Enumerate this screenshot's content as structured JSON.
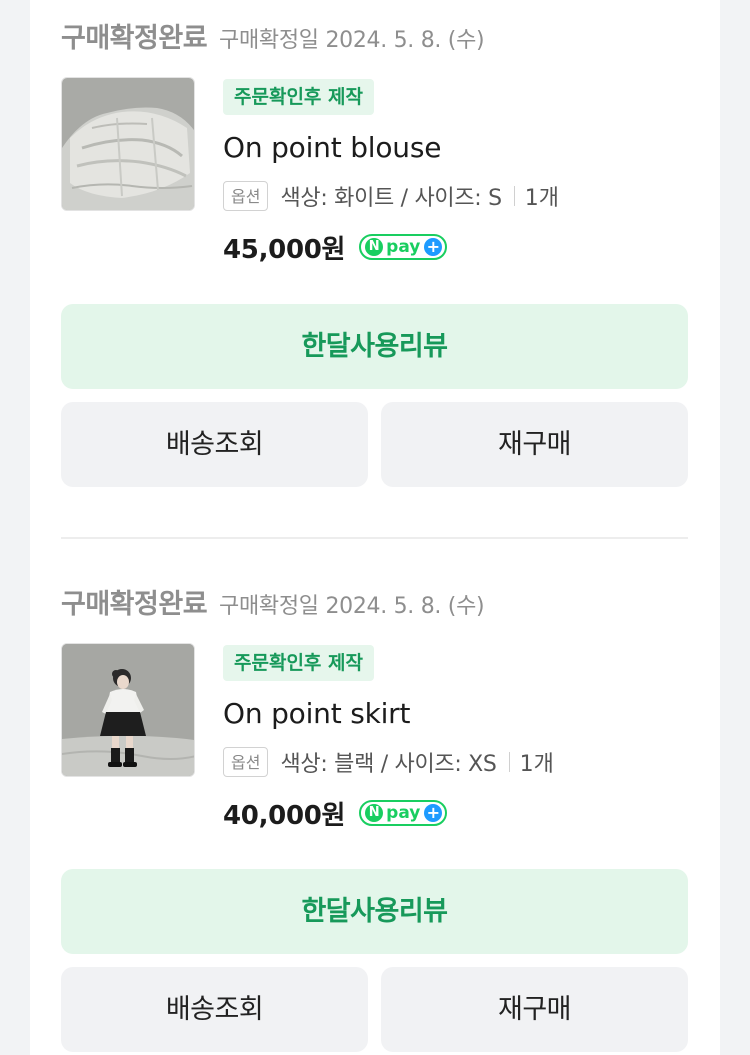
{
  "orders": [
    {
      "status": "구매확정완료",
      "confirm_date": "구매확정일 2024. 5. 8. (수)",
      "badge": "주문확인후 제작",
      "product_name": "On point blouse",
      "option_tag": "옵션",
      "option_text": "색상: 화이트 / 사이즈: S",
      "quantity": "1개",
      "price": "45,000원",
      "npay": "pay",
      "review_button": "한달사용리뷰",
      "track_button": "배송조회",
      "reorder_button": "재구매"
    },
    {
      "status": "구매확정완료",
      "confirm_date": "구매확정일 2024. 5. 8. (수)",
      "badge": "주문확인후 제작",
      "product_name": "On point skirt",
      "option_tag": "옵션",
      "option_text": "색상: 블랙 / 사이즈: XS",
      "quantity": "1개",
      "price": "40,000원",
      "npay": "pay",
      "review_button": "한달사용리뷰",
      "track_button": "배송조회",
      "reorder_button": "재구매"
    }
  ],
  "icons": {
    "npay_logo": "naver-pay-plus-icon",
    "npay_letter": "N",
    "npay_plus": "+"
  },
  "colors": {
    "accent_green": "#17995a",
    "review_bg": "#e3f6ea",
    "badge_bg": "#e6f6ec",
    "npay_green": "#19ce60",
    "npay_blue": "#1e9bff",
    "muted_text": "#8e8e8e",
    "button_gray": "#f1f2f4"
  }
}
